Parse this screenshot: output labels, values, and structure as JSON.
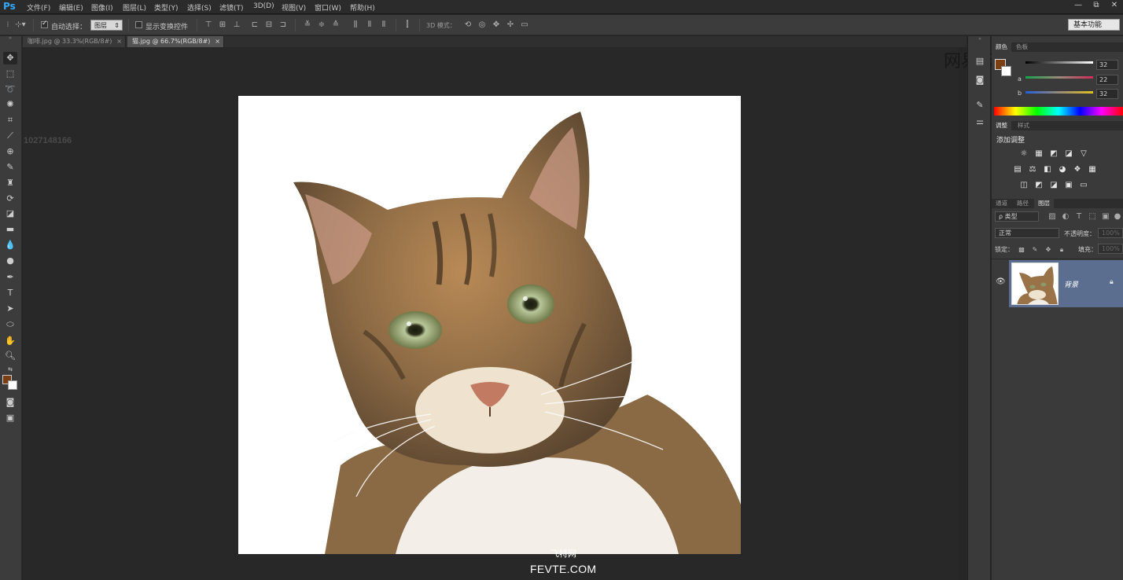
{
  "app": {
    "logo": "Ps"
  },
  "menu": [
    "文件(F)",
    "编辑(E)",
    "图像(I)",
    "图层(L)",
    "类型(Y)",
    "选择(S)",
    "滤镜(T)",
    "3D(D)",
    "视图(V)",
    "窗口(W)",
    "帮助(H)"
  ],
  "window_controls": {
    "minimize": "—",
    "restore": "⧉",
    "close": "✕"
  },
  "options_bar": {
    "auto_select_label": "自动选择：",
    "auto_select_checked": true,
    "auto_select_target": "图层",
    "show_transform_label": "显示变换控件",
    "show_transform_checked": false,
    "mode_3d_label": "3D 模式：",
    "workspace": "基本功能"
  },
  "tabs": [
    {
      "label": "咖啡.jpg @ 33.3%(RGB/8#)",
      "close": "×",
      "active": false
    },
    {
      "label": "猫.jpg @ 66.7%(RGB/8#)",
      "close": "×",
      "active": true
    }
  ],
  "canvas": {
    "side_number": "1027148166"
  },
  "watermarks": {
    "line1": "飞特网",
    "line2": "FEVTE.COM",
    "logo_text": "网易云课堂"
  },
  "color_panel": {
    "tabs": [
      "颜色",
      "色板"
    ],
    "sliders": [
      {
        "label": "",
        "value": "32",
        "gradient": "linear-gradient(90deg,#000,#fff)"
      },
      {
        "label": "a",
        "value": "22",
        "gradient": "linear-gradient(90deg,#1aa14a,#9a8a7a,#d12a5a)"
      },
      {
        "label": "b",
        "value": "32",
        "gradient": "linear-gradient(90deg,#2460d8,#9a8a7a,#e0c020)"
      }
    ],
    "foreground": "#7a3f12",
    "background": "#ffffff"
  },
  "adjust_panel": {
    "tabs": [
      "调整",
      "样式"
    ],
    "title": "添加调整",
    "row1": [
      "☼",
      "▦",
      "◩",
      "◪",
      "▽"
    ],
    "row2": [
      "▤",
      "⚖",
      "◧",
      "◕",
      "❖",
      "▦"
    ],
    "row3": [
      "◫",
      "◩",
      "◪",
      "▣",
      "▭"
    ]
  },
  "layers_panel": {
    "tabs": [
      "通道",
      "路径",
      "图层"
    ],
    "filter_label": "ρ 类型",
    "blend_mode": "正常",
    "opacity_label": "不透明度：",
    "opacity_value": "100%",
    "lock_label": "锁定：",
    "fill_label": "填充：",
    "fill_value": "100%",
    "layers": [
      {
        "name": "背景",
        "visible": true,
        "locked": true
      }
    ]
  },
  "colors": {
    "accent": "#31a8ff",
    "selected_layer": "#5b6e8f"
  }
}
